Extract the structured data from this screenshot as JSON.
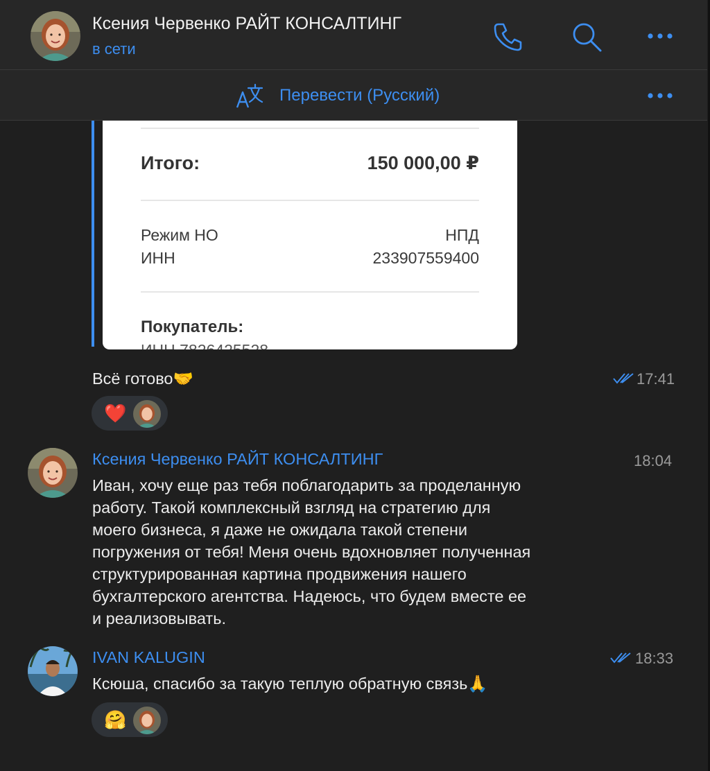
{
  "header": {
    "contact_name": "Ксения Червенко РАЙТ КОНСАЛТИНГ",
    "status": "в сети",
    "icons": [
      "phone-icon",
      "search-icon",
      "more-icon"
    ]
  },
  "translate_bar": {
    "label": "Перевести (Русский)",
    "icons": [
      "translate-icon",
      "more-icon"
    ]
  },
  "receipt": {
    "total_label": "Итого:",
    "total_value": "150 000,00 ₽",
    "tax_mode_label": "Режим НО",
    "tax_mode_value": "НПД",
    "inn_label": "ИНН",
    "inn_value": "233907559400",
    "buyer_label": "Покупатель:",
    "buyer_cut_text": "ИНН 7826425528"
  },
  "messages": [
    {
      "text": "Всё готово🤝",
      "time": "17:41",
      "read": true,
      "reaction": "❤️"
    },
    {
      "sender": "Ксения Червенко РАЙТ КОНСАЛТИНГ",
      "time": "18:04",
      "lines": [
        "Иван, хочу еще раз тебя поблагодарить за проделанную",
        "работу. Такой комплексный взгляд на стратегию для",
        "моего бизнеса, я даже не ожидала такой степени",
        "погружения от тебя! Меня очень вдохновляет полученная",
        "структурированная картина продвижения нашего",
        "бухгалтерского агентства. Надеюсь, что будем вместе ее",
        "и реализовывать."
      ]
    },
    {
      "sender": "IVAN KALUGIN",
      "time": "18:33",
      "read": true,
      "text": "Ксюша, спасибо за такую теплую обратную связь🙏",
      "reaction": "🤗"
    }
  ],
  "colors": {
    "background": "#1f1f1f",
    "header": "#272727",
    "accent": "#3d8ef0",
    "text": "#ececec",
    "muted": "#9a9a9a"
  }
}
